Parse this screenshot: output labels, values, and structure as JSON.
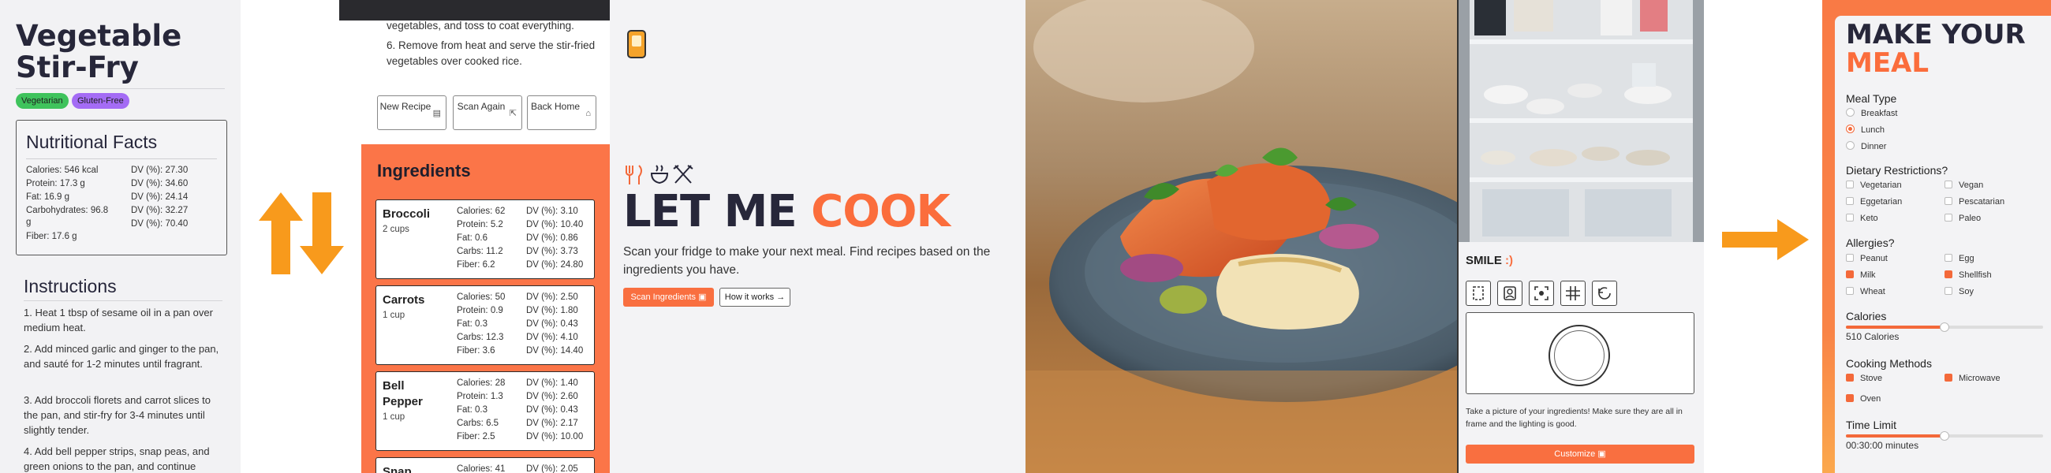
{
  "recipe": {
    "title": "Vegetable Stir-Fry",
    "tags": [
      "Vegetarian",
      "Gluten-Free"
    ],
    "nutrition_title": "Nutritional Facts",
    "nutrition_left": [
      "Calories: 546 kcal",
      "Protein: 17.3 g",
      "Fat: 16.9 g",
      "Carbohydrates: 96.8",
      "g",
      "Fiber: 17.6 g"
    ],
    "nutrition_right": [
      "DV (%): 27.30",
      "DV (%): 34.60",
      "DV (%): 24.14",
      "DV (%): 32.27",
      "DV (%): 70.40"
    ],
    "instructions_title": "Instructions",
    "steps": [
      "1. Heat 1 tbsp of sesame oil in a pan over medium heat.",
      "2. Add minced garlic and ginger to the pan, and sauté for 1-2 minutes until fragrant.",
      "3. Add broccoli florets and carrot slices to the pan, and stir-fry for 3-4 minutes until slightly tender.",
      "4. Add bell pepper strips, snap peas, and green onions to the pan, and continue"
    ]
  },
  "ingredients_view": {
    "top_lines": [
      "vegetables, and toss to coat everything.",
      "6. Remove from heat and serve the stir-fried vegetables over cooked rice."
    ],
    "nav": [
      {
        "label": "New Recipe",
        "icon": "recipe-icon"
      },
      {
        "label": "Scan Again",
        "icon": "expand-icon"
      },
      {
        "label": "Back Home",
        "icon": "home-icon"
      }
    ],
    "title": "Ingredients",
    "items": [
      {
        "name": "Broccoli",
        "amount": "2 cups",
        "left": [
          "Calories: 62",
          "Protein: 5.2",
          "Fat: 0.6",
          "Carbs: 11.2",
          "Fiber: 6.2"
        ],
        "right": [
          "DV (%): 3.10",
          "DV (%): 10.40",
          "DV (%): 0.86",
          "DV (%): 3.73",
          "DV (%): 24.80"
        ]
      },
      {
        "name": "Carrots",
        "amount": "1 cup",
        "left": [
          "Calories: 50",
          "Protein: 0.9",
          "Fat: 0.3",
          "Carbs: 12.3",
          "Fiber: 3.6"
        ],
        "right": [
          "DV (%): 2.50",
          "DV (%): 1.80",
          "DV (%): 0.43",
          "DV (%): 4.10",
          "DV (%): 14.40"
        ]
      },
      {
        "name": "Bell Pepper",
        "amount": "1 cup",
        "left": [
          "Calories: 28",
          "Protein: 1.3",
          "Fat: 0.3",
          "Carbs: 6.5",
          "Fiber: 2.5"
        ],
        "right": [
          "DV (%): 1.40",
          "DV (%): 2.60",
          "DV (%): 0.43",
          "DV (%): 2.17",
          "DV (%): 10.00"
        ]
      },
      {
        "name": "Snap",
        "amount": "",
        "left": [
          "Calories: 41"
        ],
        "right": [
          "DV (%): 2.05"
        ]
      }
    ]
  },
  "hero": {
    "title_dark": "LET ME",
    "title_accent": "COOK",
    "subtitle": "Scan your fridge to make your next meal. Find recipes based on the ingredients you have.",
    "scan_button": "Scan Ingredients",
    "how_button": "How it works",
    "accent_color": "#fb6d3c"
  },
  "camera": {
    "title": "SMILE",
    "title_accent": ":)",
    "tools": [
      "crop-icon",
      "portrait-icon",
      "focus-icon",
      "grid-icon",
      "refresh-icon"
    ],
    "hint": "Take a picture of your ingredients! Make sure they are all in frame and the lighting is good.",
    "customize_button": "Customize"
  },
  "meal_form": {
    "title_dark": "MAKE YOUR",
    "title_accent": "MEAL",
    "meal_type_label": "Meal Type",
    "meal_types": [
      {
        "label": "Breakfast",
        "selected": false
      },
      {
        "label": "Lunch",
        "selected": true
      },
      {
        "label": "Dinner",
        "selected": false
      }
    ],
    "dietary_label": "Dietary Restrictions?",
    "dietary": [
      {
        "label": "Vegetarian",
        "checked": false
      },
      {
        "label": "Vegan",
        "checked": false
      },
      {
        "label": "Eggetarian",
        "checked": false
      },
      {
        "label": "Pescatarian",
        "checked": false
      },
      {
        "label": "Keto",
        "checked": false
      },
      {
        "label": "Paleo",
        "checked": false
      }
    ],
    "allergies_label": "Allergies?",
    "allergies": [
      {
        "label": "Peanut",
        "checked": false
      },
      {
        "label": "Egg",
        "checked": false
      },
      {
        "label": "Milk",
        "checked": true
      },
      {
        "label": "Shellfish",
        "checked": true
      },
      {
        "label": "Wheat",
        "checked": false
      },
      {
        "label": "Soy",
        "checked": false
      }
    ],
    "calories_label": "Calories",
    "calories_value": "510 Calories",
    "calories_fraction": 0.5,
    "cooking_label": "Cooking Methods",
    "cooking": [
      {
        "label": "Stove",
        "checked": true
      },
      {
        "label": "Microwave",
        "checked": true
      },
      {
        "label": "Oven",
        "checked": true
      }
    ],
    "time_label": "Time Limit",
    "time_value": "00:30:00 minutes",
    "time_fraction": 0.5
  }
}
